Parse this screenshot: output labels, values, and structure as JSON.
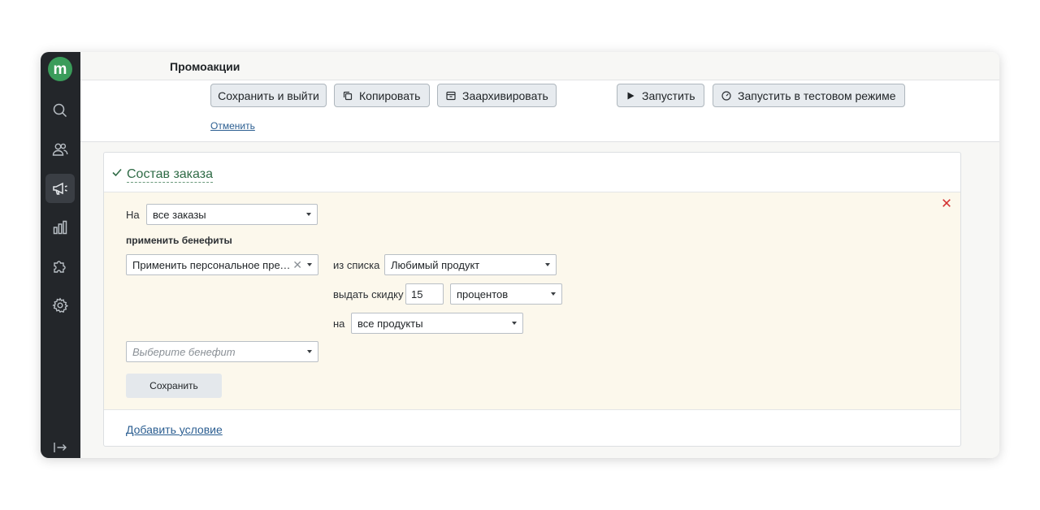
{
  "app": {
    "logo_letter": "m",
    "accent_color": "#3a9c5a"
  },
  "sidebar": {
    "items": [
      {
        "name": "search-icon"
      },
      {
        "name": "users-icon"
      },
      {
        "name": "megaphone-icon",
        "active": true
      },
      {
        "name": "analytics-icon"
      },
      {
        "name": "puzzle-icon"
      },
      {
        "name": "gear-icon"
      }
    ],
    "bottom": {
      "name": "logout-icon"
    }
  },
  "header": {
    "title": "Промоакции",
    "buttons": {
      "save_exit": "Сохранить и выйти",
      "copy": "Копировать",
      "archive": "Заархивировать",
      "run": "Запустить",
      "run_test": "Запустить в тестовом режиме"
    },
    "cancel": "Отменить"
  },
  "section": {
    "title": "Состав заказа",
    "on_label": "На",
    "on_value": "все заказы",
    "apply_benefits_label": "применить бенефиты",
    "benefit_value": "Применить персональное предло...",
    "from_list_label": "из списка",
    "from_list_value": "Любимый продукт",
    "discount_label": "выдать скидку",
    "discount_value": "15",
    "discount_unit": "процентов",
    "for_label": "на",
    "for_value": "все продукты",
    "benefit_placeholder": "Выберите бенефит",
    "save_button": "Сохранить",
    "add_condition": "Добавить условие"
  },
  "colors": {
    "sidebar_bg": "#23262a",
    "condition_bg": "#fcf8ec",
    "link": "#2b5e91",
    "section_title": "#2f6b46",
    "remove": "#d32f2f"
  }
}
